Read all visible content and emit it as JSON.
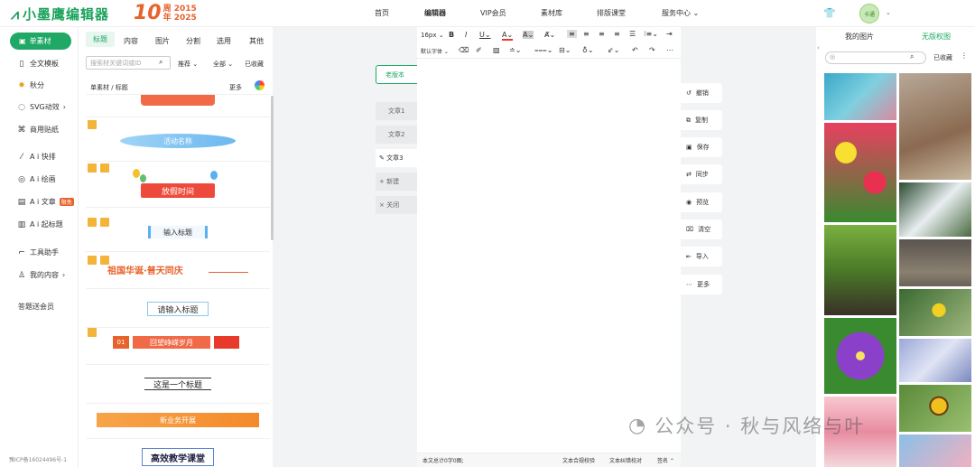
{
  "brand": {
    "logo_text": "小墨鹰编辑器",
    "anniv_big": "10",
    "anniv_line1": "周 2015",
    "anniv_line2": "年 2025"
  },
  "nav": [
    "首页",
    "编辑器",
    "VIP会员",
    "素材库",
    "排版课堂",
    "服务中心"
  ],
  "avatar_text": "卡通",
  "sidebar": {
    "primary": "单素材",
    "items": [
      "全文模板",
      "秋分",
      "SVG动效",
      "商用贴纸",
      "A i 快排",
      "A i 绘画",
      "A i 文章",
      "A i 起标题",
      "工具助手",
      "我的内容",
      "答题送会员"
    ],
    "badge": "限免"
  },
  "icp": "豫ICP备16024496号-1",
  "material": {
    "tabs": [
      "标题",
      "内容",
      "图片",
      "分割",
      "选用",
      "其他"
    ],
    "search_placeholder": "搜索材关键词或ID",
    "filters": [
      "推荐",
      "全部",
      "已收藏"
    ],
    "breadcrumb": "单素材 / 标题",
    "more": "更多",
    "templates": [
      "活动名称",
      "放假时间",
      "输入标题",
      "祖国华诞·普天同庆",
      "请输入标题",
      "回望峥嵘岁月",
      "这是一个标题",
      "新业务开展",
      "高效教学课堂"
    ],
    "tpl_num": "01"
  },
  "versions": {
    "label": "老版本",
    "articles": [
      "文章1",
      "文章2",
      "文章3"
    ],
    "new": "新建",
    "close": "关闭"
  },
  "toolbar": {
    "font_size": "16px",
    "font_family": "默认字体"
  },
  "footer": {
    "count": "本文总计0字0图;",
    "check": "文本合规校验",
    "correct": "文本纠错校对",
    "sign": "签名"
  },
  "actions": [
    "撤销",
    "复制",
    "保存",
    "同步",
    "预览",
    "清空",
    "导入",
    "更多"
  ],
  "right": {
    "tab_mine": "我的图片",
    "tab_free": "无版权图",
    "fav": "已收藏"
  },
  "watermark": "公众号 · 秋与风络与叶",
  "colors": {
    "accent": "#20a866",
    "orange": "#e8622c"
  }
}
